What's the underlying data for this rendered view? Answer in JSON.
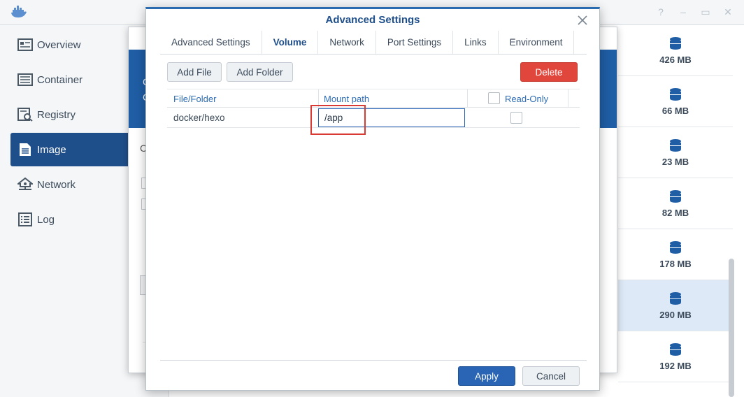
{
  "app": {
    "window_controls": [
      "?",
      "–",
      "▭",
      "✕"
    ]
  },
  "sidebar": {
    "items": [
      {
        "label": "Overview",
        "icon": "overview-icon"
      },
      {
        "label": "Container",
        "icon": "container-icon"
      },
      {
        "label": "Registry",
        "icon": "registry-icon"
      },
      {
        "label": "Image",
        "icon": "image-icon",
        "active": true
      },
      {
        "label": "Network",
        "icon": "network-icon"
      },
      {
        "label": "Log",
        "icon": "log-icon"
      }
    ]
  },
  "image_sizes": [
    "426 MB",
    "66 MB",
    "23 MB",
    "82 MB",
    "178 MB",
    "290 MB",
    "192 MB"
  ],
  "background_dialog": {
    "fragments": [
      "C",
      "C",
      "C"
    ]
  },
  "dialog": {
    "title": "Advanced Settings",
    "tabs": [
      {
        "label": "Advanced Settings"
      },
      {
        "label": "Volume",
        "active": true
      },
      {
        "label": "Network"
      },
      {
        "label": "Port Settings"
      },
      {
        "label": "Links"
      },
      {
        "label": "Environment"
      }
    ],
    "toolbar": {
      "add_file": "Add File",
      "add_folder": "Add Folder",
      "delete": "Delete"
    },
    "grid": {
      "headers": {
        "file_folder": "File/Folder",
        "mount_path": "Mount path",
        "read_only": "Read-Only"
      },
      "rows": [
        {
          "file_folder": "docker/hexo",
          "mount_path": "/app",
          "read_only": false
        }
      ]
    },
    "footer": {
      "apply": "Apply",
      "cancel": "Cancel"
    }
  },
  "colors": {
    "accent": "#1f4f8a",
    "header_text": "#2f6db5",
    "delete": "#e0463c",
    "apply": "#2a65b5",
    "highlight": "#d93a34"
  }
}
